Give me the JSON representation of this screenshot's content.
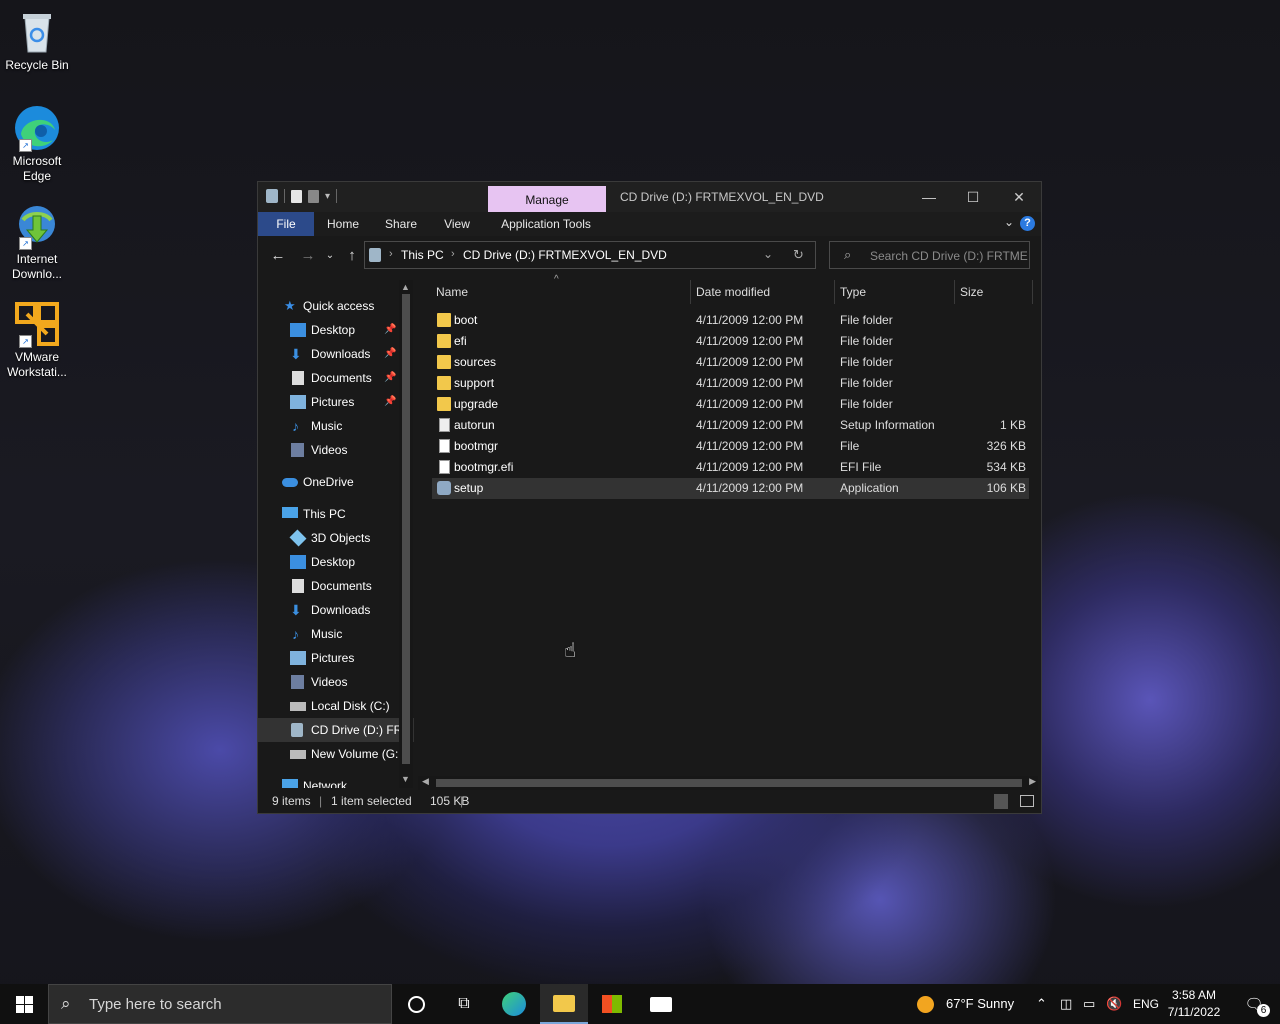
{
  "desktop": {
    "icons": [
      {
        "label_lines": [
          "Recycle Bin"
        ],
        "icon": "recycle-bin-icon"
      },
      {
        "label_lines": [
          "Microsoft",
          "Edge"
        ],
        "icon": "edge-icon"
      },
      {
        "label_lines": [
          "Internet",
          "Downlo..."
        ],
        "icon": "internet-download-manager-icon"
      },
      {
        "label_lines": [
          "VMware",
          "Workstati..."
        ],
        "icon": "vmware-workstation-icon"
      }
    ]
  },
  "window": {
    "title": "CD Drive (D:) FRTMEXVOL_EN_DVD",
    "manage_tab": "Manage",
    "ribbon_tabs": [
      "File",
      "Home",
      "Share",
      "View",
      "Application Tools"
    ],
    "address": {
      "segments": [
        "This PC",
        "CD Drive (D:) FRTMEXVOL_EN_DVD"
      ]
    },
    "search_placeholder": "Search CD Drive (D:) FRTMEX...",
    "nav": {
      "quick_access": "Quick access",
      "quick_items": [
        "Desktop",
        "Downloads",
        "Documents",
        "Pictures",
        "Music",
        "Videos"
      ],
      "onedrive": "OneDrive",
      "this_pc": "This PC",
      "pc_items": [
        "3D Objects",
        "Desktop",
        "Documents",
        "Downloads",
        "Music",
        "Pictures",
        "Videos",
        "Local Disk (C:)",
        "CD Drive (D:) FRT",
        "New Volume (G:"
      ],
      "network": "Network"
    },
    "columns": [
      "Name",
      "Date modified",
      "Type",
      "Size"
    ],
    "files": [
      {
        "name": "boot",
        "date": "4/11/2009 12:00 PM",
        "type": "File folder",
        "size": "",
        "kind": "folder"
      },
      {
        "name": "efi",
        "date": "4/11/2009 12:00 PM",
        "type": "File folder",
        "size": "",
        "kind": "folder"
      },
      {
        "name": "sources",
        "date": "4/11/2009 12:00 PM",
        "type": "File folder",
        "size": "",
        "kind": "folder"
      },
      {
        "name": "support",
        "date": "4/11/2009 12:00 PM",
        "type": "File folder",
        "size": "",
        "kind": "folder"
      },
      {
        "name": "upgrade",
        "date": "4/11/2009 12:00 PM",
        "type": "File folder",
        "size": "",
        "kind": "folder"
      },
      {
        "name": "autorun",
        "date": "4/11/2009 12:00 PM",
        "type": "Setup Information",
        "size": "1 KB",
        "kind": "setupinfo"
      },
      {
        "name": "bootmgr",
        "date": "4/11/2009 12:00 PM",
        "type": "File",
        "size": "326 KB",
        "kind": "file"
      },
      {
        "name": "bootmgr.efi",
        "date": "4/11/2009 12:00 PM",
        "type": "EFI File",
        "size": "534 KB",
        "kind": "file"
      },
      {
        "name": "setup",
        "date": "4/11/2009 12:00 PM",
        "type": "Application",
        "size": "106 KB",
        "kind": "app",
        "selected": true
      }
    ],
    "status": {
      "items": "9 items",
      "selected": "1 item selected",
      "size": "105 KB"
    }
  },
  "taskbar": {
    "search_placeholder": "Type here to search",
    "weather": "67°F  Sunny",
    "lang": "ENG",
    "time": "3:58 AM",
    "date": "7/11/2022",
    "notification_count": "6"
  },
  "colors": {
    "manage_tab": "#e7c4f2",
    "file_tab": "#2c4a8a",
    "folder": "#f2c84b",
    "accent": "#2b7ae0"
  }
}
